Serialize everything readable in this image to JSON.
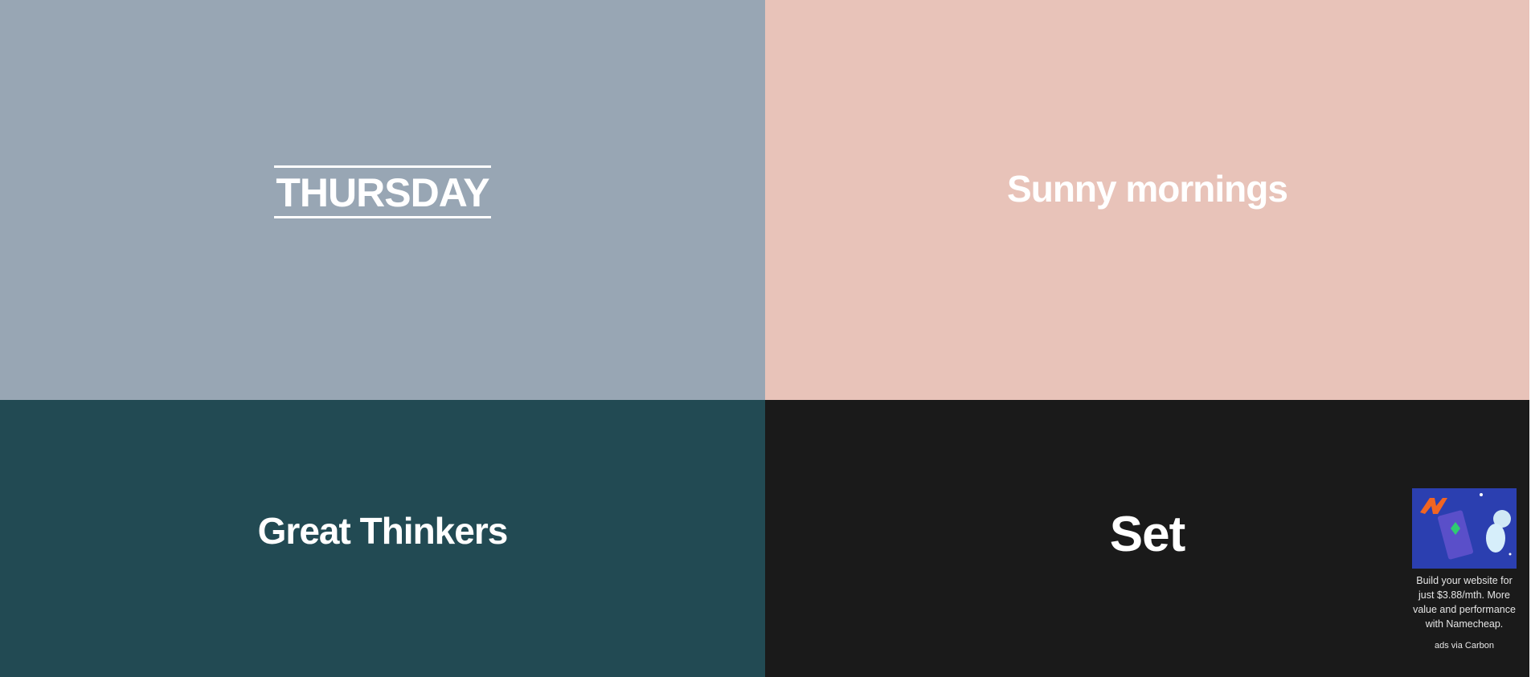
{
  "panels": {
    "day": "THURSDAY",
    "greeting": "Sunny mornings",
    "category": "Great Thinkers",
    "word": "Set"
  },
  "ad": {
    "text": "Build your website for just $3.88/mth. More value and performance with Namecheap.",
    "attribution": "ads via Carbon"
  },
  "colors": {
    "p1": "#98a6b4",
    "p2": "#e8c3b9",
    "p3": "#224a53",
    "p4": "#1a1a1a"
  }
}
